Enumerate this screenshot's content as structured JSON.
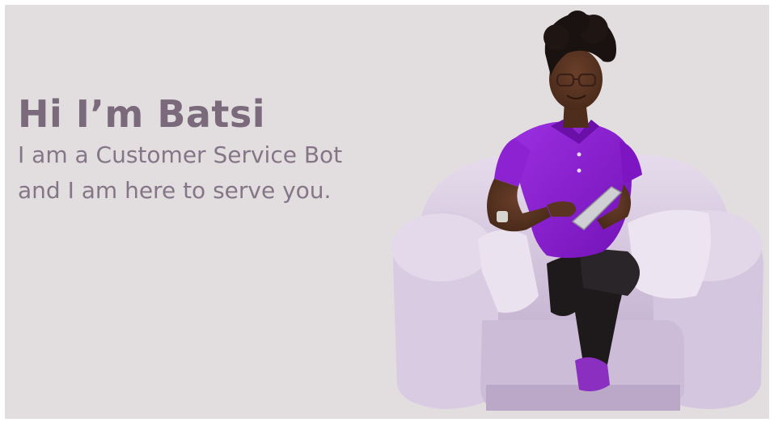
{
  "banner": {
    "headline": "Hi I’m Batsi",
    "tagline_line1": "I am a Customer Service Bot",
    "tagline_line2": "and I am here to serve you."
  },
  "colors": {
    "background": "#e2dedf",
    "text": "#7a6a7b",
    "shirt": "#8b1bd0",
    "armchair": "#d7c9e0",
    "shoes": "#8a2fc0"
  },
  "illustration": {
    "subject": "woman-avatar-in-armchair-holding-tablet"
  }
}
